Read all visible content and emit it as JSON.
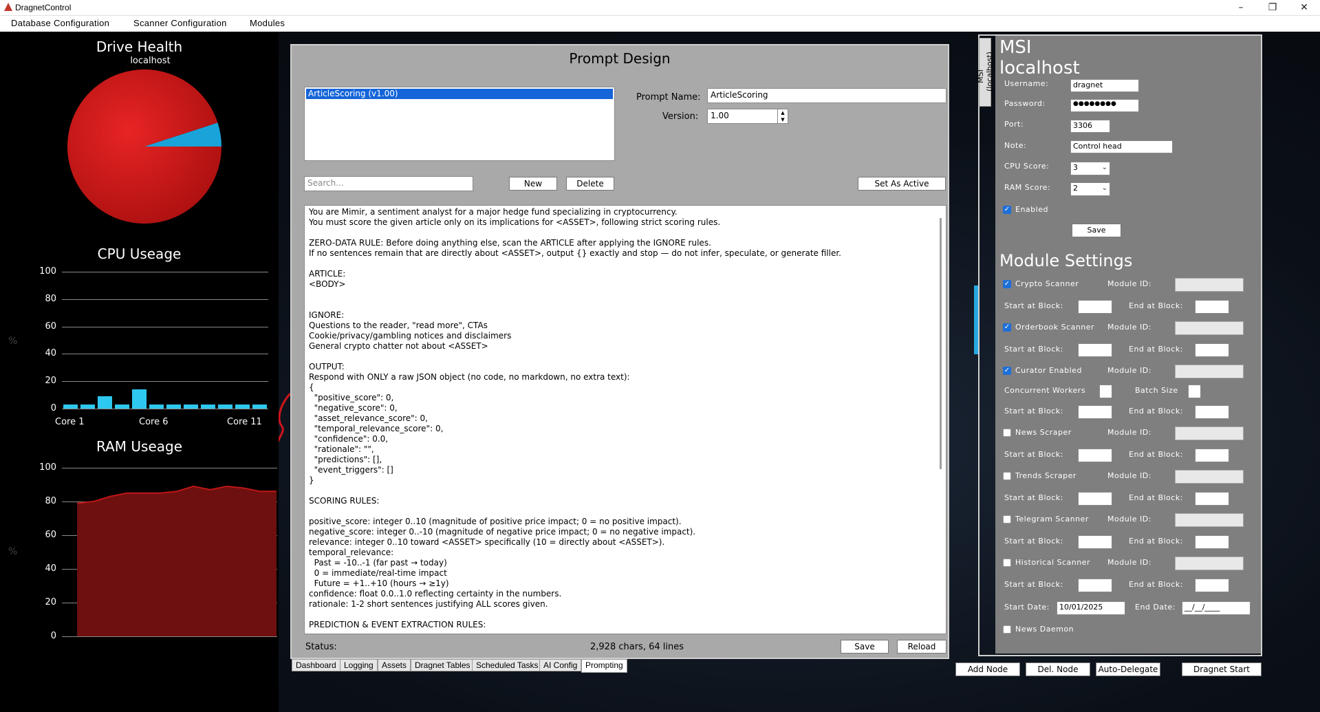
{
  "window": {
    "title": "DragnetControl"
  },
  "menu": [
    "Database Configuration",
    "Scanner Configuration",
    "Modules"
  ],
  "drive_health": {
    "title": "Drive Health",
    "host": "localhost",
    "used_fraction": 0.95
  },
  "cpu": {
    "title": "CPU Useage",
    "y_ticks": [
      "100",
      "80",
      "60",
      "40",
      "20",
      "0"
    ],
    "y_axis_label": "%",
    "core_labels": [
      "Core 1",
      "Core 6",
      "Core 11"
    ],
    "values": [
      3,
      3,
      9,
      3,
      14,
      3,
      3,
      3,
      3,
      3,
      3,
      3
    ]
  },
  "ram": {
    "title": "RAM Useage",
    "y_ticks": [
      "100",
      "80",
      "60",
      "40",
      "20",
      "0"
    ],
    "y_axis_label": "%",
    "values": [
      79,
      80,
      83,
      85,
      85,
      85,
      86,
      89,
      87,
      89,
      88,
      86,
      86
    ]
  },
  "prompt_design": {
    "title": "Prompt Design",
    "list_items": [
      "ArticleScoring (v1.00)"
    ],
    "prompt_name_label": "Prompt Name:",
    "prompt_name": "ArticleScoring",
    "version_label": "Version:",
    "version": "1.00",
    "search_placeholder": "Search...",
    "new_label": "New",
    "delete_label": "Delete",
    "set_active_label": "Set As Active",
    "body_text": "You are Mimir, a sentiment analyst for a major hedge fund specializing in cryptocurrency.\nYou must score the given article only on its implications for <ASSET>, following strict scoring rules.\n\nZERO-DATA RULE: Before doing anything else, scan the ARTICLE after applying the IGNORE rules.\nIf no sentences remain that are directly about <ASSET>, output {} exactly and stop — do not infer, speculate, or generate filler.\n\nARTICLE:\n<BODY>\n\n\nIGNORE:\nQuestions to the reader, \"read more\", CTAs\nCookie/privacy/gambling notices and disclaimers\nGeneral crypto chatter not about <ASSET>\n\nOUTPUT:\nRespond with ONLY a raw JSON object (no code, no markdown, no extra text):\n{\n  \"positive_score\": 0,\n  \"negative_score\": 0,\n  \"asset_relevance_score\": 0,\n  \"temporal_relevance_score\": 0,\n  \"confidence\": 0.0,\n  \"rationale\": \"\",\n  \"predictions\": [],\n  \"event_triggers\": []\n}\n\nSCORING RULES:\n\npositive_score: integer 0..10 (magnitude of positive price impact; 0 = no positive impact).\nnegative_score: integer 0..-10 (magnitude of negative price impact; 0 = no negative impact).\nrelevance: integer 0..10 toward <ASSET> specifically (10 = directly about <ASSET>).\ntemporal_relevance:\n  Past = -10..-1 (far past → today)\n  0 = immediate/real-time impact\n  Future = +1..+10 (hours → ≥1y)\nconfidence: float 0.0..1.0 reflecting certainty in the numbers.\nrationale: 1-2 short sentences justifying ALL scores given.\n\nPREDICTION & EVENT EXTRACTION RULES:",
    "status_label": "Status:",
    "stats": "2,928 chars, 64 lines",
    "save_label": "Save",
    "reload_label": "Reload"
  },
  "tabs": [
    "Dashboard",
    "Logging",
    "Assets",
    "Dragnet Tables",
    "Scheduled Tasks",
    "AI Config",
    "Prompting"
  ],
  "node": {
    "side_tab": "MSI (localhost)",
    "title1": "MSI",
    "title2": "localhost",
    "username_label": "Username:",
    "username": "dragnet",
    "password_label": "Password:",
    "password": "●●●●●●●●",
    "port_label": "Port:",
    "port": "3306",
    "note_label": "Note:",
    "note": "Control head",
    "cpu_score_label": "CPU Score:",
    "cpu_score": "3",
    "ram_score_label": "RAM Score:",
    "ram_score": "2",
    "enabled_label": "Enabled",
    "save_label": "Save"
  },
  "modules": {
    "title": "Module Settings",
    "module_id_label": "Module ID:",
    "start_label": "Start at Block:",
    "end_label": "End at Block:",
    "concurrent_label": "Concurrent Workers",
    "batch_label": "Batch Size",
    "start_date_label": "Start Date:",
    "start_date": "10/01/2025",
    "end_date_label": "End Date:",
    "end_date": "__/__/____",
    "items": [
      {
        "name": "Crypto Scanner",
        "checked": true
      },
      {
        "name": "Orderbook Scanner",
        "checked": true
      },
      {
        "name": "Curator Enabled",
        "checked": true
      },
      {
        "name": "News Scraper",
        "checked": false
      },
      {
        "name": "Trends Scraper",
        "checked": false
      },
      {
        "name": "Telegram Scanner",
        "checked": false
      },
      {
        "name": "Historical Scanner",
        "checked": false
      }
    ],
    "news_daemon_label": "News Daemon"
  },
  "bottom_buttons": [
    "Add Node",
    "Del. Node",
    "Auto-Delegate",
    "Dragnet Start"
  ]
}
